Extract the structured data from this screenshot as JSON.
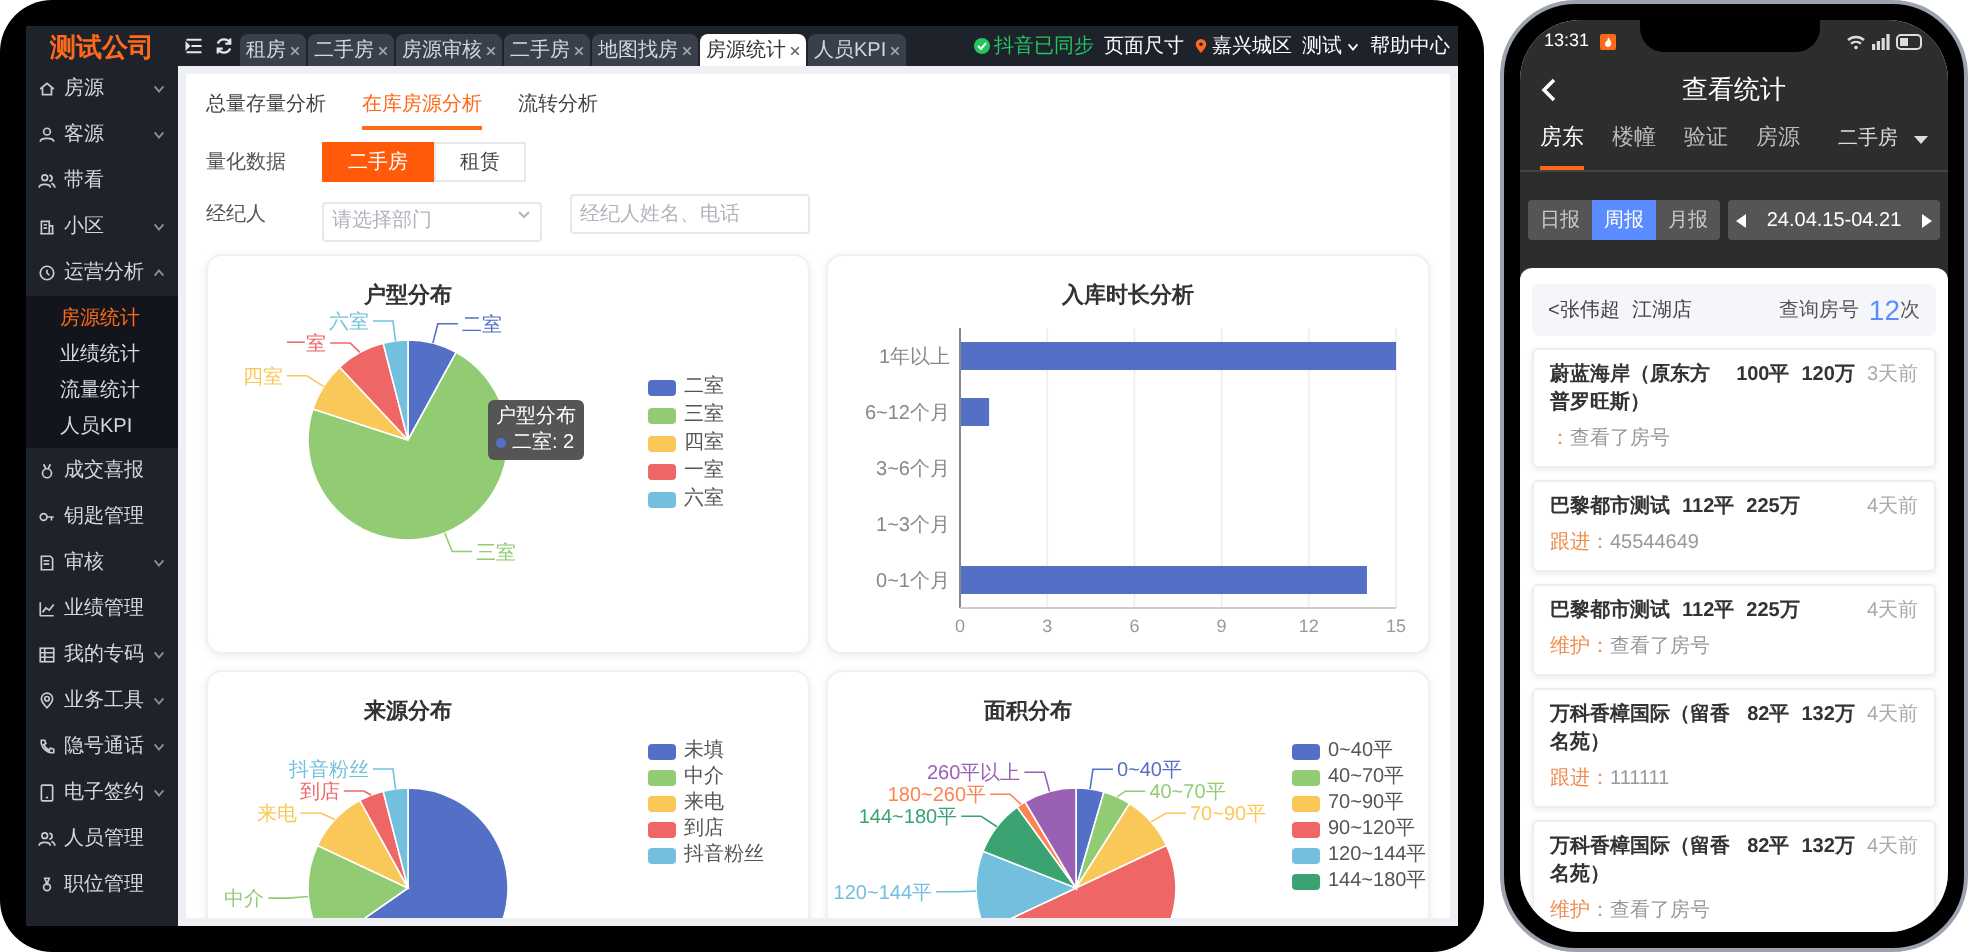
{
  "laptop": {
    "logo": "测试公司",
    "sidebar": [
      {
        "label": "房源",
        "expanded": false
      },
      {
        "label": "客源",
        "expanded": false
      },
      {
        "label": "带看"
      },
      {
        "label": "小区",
        "expanded": false
      },
      {
        "label": "运营分析",
        "expanded": true,
        "children": [
          {
            "label": "房源统计",
            "selected": true
          },
          {
            "label": "业绩统计",
            "selected": false
          },
          {
            "label": "流量统计",
            "selected": false
          },
          {
            "label": "人员KPI",
            "selected": false
          }
        ]
      },
      {
        "label": "成交喜报"
      },
      {
        "label": "钥匙管理"
      },
      {
        "label": "审核",
        "expanded": false
      },
      {
        "label": "业绩管理"
      },
      {
        "label": "我的专码",
        "expanded": false
      },
      {
        "label": "业务工具",
        "expanded": false
      },
      {
        "label": "隐号通话",
        "expanded": false
      },
      {
        "label": "电子签约",
        "expanded": false
      },
      {
        "label": "人员管理"
      },
      {
        "label": "职位管理"
      }
    ],
    "tabs": [
      {
        "label": "租房",
        "selected": false
      },
      {
        "label": "二手房",
        "selected": false
      },
      {
        "label": "房源审核",
        "selected": false
      },
      {
        "label": "二手房",
        "selected": false
      },
      {
        "label": "地图找房",
        "selected": false
      },
      {
        "label": "房源统计",
        "selected": true
      },
      {
        "label": "人员KPI",
        "selected": false
      }
    ],
    "toolbar": [
      {
        "kind": "status",
        "label": "抖音已同步"
      },
      {
        "kind": "link",
        "label": "页面尺寸"
      },
      {
        "kind": "location",
        "label": "嘉兴城区"
      },
      {
        "kind": "menu",
        "label": "测试"
      },
      {
        "kind": "link",
        "label": "帮助中心"
      }
    ],
    "subtabs": [
      {
        "label": "总量存量分析",
        "selected": false
      },
      {
        "label": "在库房源分析",
        "selected": true
      },
      {
        "label": "流转分析",
        "selected": false
      }
    ],
    "filters": {
      "quantify_label": "量化数据",
      "segments": [
        {
          "label": "二手房",
          "selected": true
        },
        {
          "label": "租赁",
          "selected": false
        }
      ],
      "agent_label": "经纪人",
      "department": {
        "placeholder": "请选择部门"
      },
      "search": {
        "placeholder": "经纪人姓名、电话"
      }
    },
    "cards": [
      {
        "kind": "pie",
        "title": "户型分布",
        "labels": [
          "六室",
          "二室",
          "一室",
          "四室",
          "三室"
        ],
        "legend": [
          {
            "label": "二室",
            "color": "#5470c6"
          },
          {
            "label": "三室",
            "color": "#91cc75"
          },
          {
            "label": "四室",
            "color": "#fac858"
          },
          {
            "label": "一室",
            "color": "#ee6666"
          },
          {
            "label": "六室",
            "color": "#73c0de"
          }
        ],
        "tooltip": {
          "title": "户型分布",
          "text": "二室: 2"
        }
      },
      {
        "kind": "bar",
        "title": "入库时长分析",
        "chart_data": {
          "type": "bar",
          "orientation": "horizontal",
          "grid": true,
          "categories": [
            "1年以上",
            "6~12个月",
            "3~6个月",
            "1~3个月",
            "0~1个月"
          ],
          "series": [
            {
              "color": "#5470c6",
              "values": [
                15,
                1,
                0,
                0,
                14
              ]
            }
          ],
          "xlim": [
            0,
            15
          ],
          "xticks": [
            0,
            3,
            6,
            9,
            12,
            15
          ]
        }
      },
      {
        "kind": "pie",
        "title": "来源分布",
        "labels": [
          "抖音粉丝",
          "到店",
          "来电",
          "中介"
        ],
        "legend": [
          {
            "label": "未填",
            "color": "#5470c6"
          },
          {
            "label": "中介",
            "color": "#91cc75"
          },
          {
            "label": "来电",
            "color": "#fac858"
          },
          {
            "label": "到店",
            "color": "#ee6666"
          },
          {
            "label": "抖音粉丝",
            "color": "#73c0de"
          }
        ]
      },
      {
        "kind": "pie",
        "title": "面积分布",
        "labels": [
          "0~40平",
          "260平以上",
          "40~70平",
          "180~260平",
          "70~90平",
          "144~180平",
          "120~144平"
        ],
        "legend": [
          {
            "label": "0~40平",
            "color": "#5470c6"
          },
          {
            "label": "40~70平",
            "color": "#91cc75"
          },
          {
            "label": "70~90平",
            "color": "#fac858"
          },
          {
            "label": "90~120平",
            "color": "#ee6666"
          },
          {
            "label": "120~144平",
            "color": "#73c0de"
          },
          {
            "label": "144~180平",
            "color": "#3ba272"
          }
        ]
      }
    ]
  },
  "phone": {
    "time": "13:31",
    "title": "查看统计",
    "tabs": [
      {
        "label": "房东",
        "selected": true
      },
      {
        "label": "楼幢",
        "selected": false
      },
      {
        "label": "验证",
        "selected": false
      },
      {
        "label": "房源",
        "selected": false
      }
    ],
    "type_select": "二手房",
    "periods": [
      {
        "label": "日报",
        "selected": false
      },
      {
        "label": "周报",
        "selected": true
      },
      {
        "label": "月报",
        "selected": false
      }
    ],
    "date_range": "24.04.15-04.21",
    "agent": {
      "name": "<张伟超",
      "store": "江湖店",
      "query_label": "查询房号",
      "query_count": "12",
      "query_unit": "次"
    },
    "records": [
      {
        "name": "蔚蓝海岸（原东方普罗旺斯）",
        "area": "100平",
        "price": "120万",
        "time": "3天前",
        "tag": "：",
        "note": "查看了房号"
      },
      {
        "name": "巴黎都市测试",
        "area": "112平",
        "price": "225万",
        "time": "4天前",
        "tag": "跟进：",
        "note": "45544649"
      },
      {
        "name": "巴黎都市测试",
        "area": "112平",
        "price": "225万",
        "time": "4天前",
        "tag": "维护：",
        "note": "查看了房号"
      },
      {
        "name": "万科香樟国际（留香名苑）",
        "area": "82平",
        "price": "132万",
        "time": "4天前",
        "tag": "跟进：",
        "note": "111111"
      },
      {
        "name": "万科香樟国际（留香名苑）",
        "area": "82平",
        "price": "132万",
        "time": "4天前",
        "tag": "维护：",
        "note": "查看了房号"
      }
    ]
  }
}
